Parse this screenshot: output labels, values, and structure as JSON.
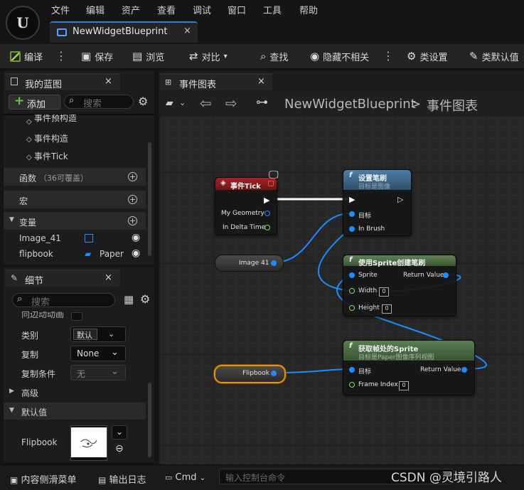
{
  "menu": {
    "logo": "U",
    "items": [
      "文件",
      "编辑",
      "资产",
      "查看",
      "调试",
      "窗口",
      "工具",
      "帮助"
    ],
    "doc_tab": "NewWidgetBlueprint",
    "doc_tab_close": "×"
  },
  "toolbar": {
    "compile": "编译",
    "save": "保存",
    "browse": "浏览",
    "diff": "对比",
    "find": "查找",
    "hide_unrelated": "隐藏不相关",
    "class_settings": "类设置",
    "class_defaults": "类默认值"
  },
  "my_blueprint": {
    "tab": "我的蓝图",
    "close": "×",
    "add_button": "添加",
    "search_placeholder": "搜索",
    "events": [
      "事件预构造",
      "事件构造",
      "事件Tick"
    ],
    "functions_label": "函数",
    "functions_note": "（36可覆盖）",
    "macros_label": "宏",
    "variables_label": "变量",
    "variables": [
      {
        "name": "Image_41",
        "type": ""
      },
      {
        "name": "flipbook",
        "type": "Paper"
      }
    ]
  },
  "details": {
    "tab": "细节",
    "close": "×",
    "search_placeholder": "搜索",
    "partial_row": "向边动动画",
    "category_label": "类别",
    "category_value": "默认",
    "replication_label": "复制",
    "replication_value": "None",
    "rep_condition_label": "复制条件",
    "rep_condition_value": "无",
    "advanced_label": "高级",
    "defaults_label": "默认值",
    "flipbook_label": "Flipbook"
  },
  "graph": {
    "tab": "事件图表",
    "close": "×",
    "breadcrumb_root": "NewWidgetBlueprint",
    "breadcrumb_sep": ">",
    "breadcrumb_current": "事件图表",
    "nodes": {
      "event_tick": {
        "title": "事件Tick",
        "pins": [
          "My Geometry",
          "In Delta Time"
        ]
      },
      "set_brush": {
        "title": "设置笔刷",
        "subtitle": "目标是图像",
        "pins": [
          "目标",
          "In Brush"
        ]
      },
      "make_brush": {
        "title": "使用Sprite创建笔刷",
        "pins": [
          "Sprite",
          "Return Value",
          "Width",
          "Height"
        ],
        "width_value": "0",
        "height_value": "0"
      },
      "get_sprite": {
        "title": "获取帧处的Sprite",
        "subtitle": "目标是Paper图像序列视图",
        "pins": [
          "目标",
          "Return Value",
          "Frame Index"
        ],
        "frame_value": "0"
      },
      "image41": {
        "label": "Image 41"
      },
      "flipbook": {
        "label": "Flipbook"
      }
    },
    "function_glyph": "f"
  },
  "bottom": {
    "content_drawer": "内容侧滑菜单",
    "output_log": "输出日志",
    "cmd": "Cmd",
    "console_placeholder": "输入控制台命令",
    "watermark": "CSDN @灵境引路人"
  },
  "colors": {
    "accent": "#2a7de1",
    "exec_header": "#8b1e1e",
    "set_header": "#3f6a8c",
    "func_header": "#4e6e46",
    "wire_blue": "#1e8bff",
    "add_green": "#5fcf4a"
  }
}
